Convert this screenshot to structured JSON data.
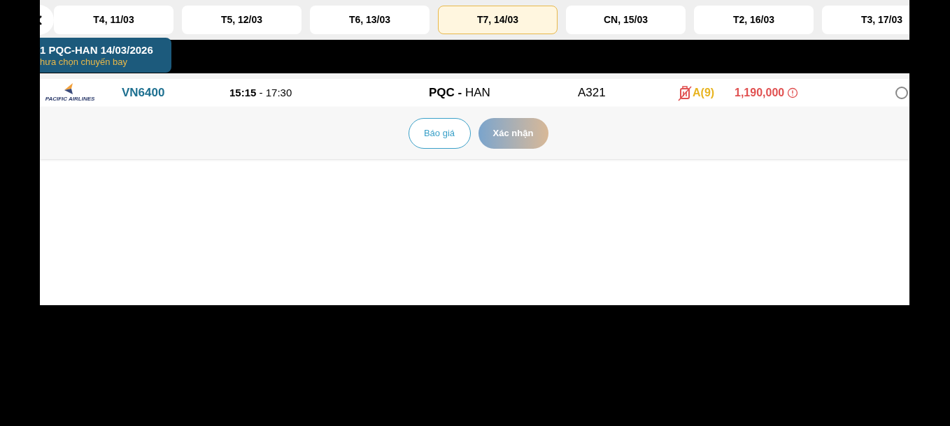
{
  "date_tabs": [
    {
      "label": "T4, 11/03",
      "selected": false
    },
    {
      "label": "T5, 12/03",
      "selected": false
    },
    {
      "label": "T6, 13/03",
      "selected": false
    },
    {
      "label": "T7, 14/03",
      "selected": true
    },
    {
      "label": "CN, 15/03",
      "selected": false
    },
    {
      "label": "T2, 16/03",
      "selected": false
    },
    {
      "label": "T3, 17/03",
      "selected": false
    }
  ],
  "segment": {
    "title": "1 PQC-HAN 14/03/2026",
    "subtitle": "hưa chọn chuyến bay"
  },
  "flights": [
    {
      "airline": "PACIFIC AIRLINES",
      "flight_number": "VN6400",
      "depart": "15:15",
      "time_separator": "-",
      "arrive": "17:30",
      "route_separator": "-",
      "from": "PQC",
      "to": "HAN",
      "aircraft": "A321",
      "baggage_included": false,
      "fare_class": "A(9)",
      "price": "1,190,000",
      "selected": false
    }
  ],
  "buttons": {
    "quote": "Báo giá",
    "confirm": "Xác nhận"
  }
}
